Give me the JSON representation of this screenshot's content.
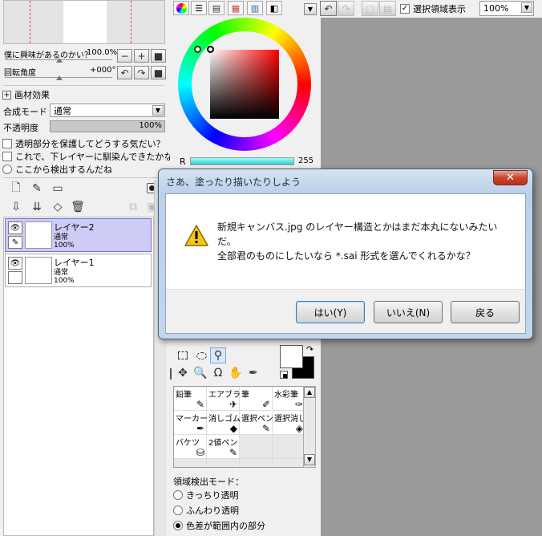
{
  "navigator": {
    "zoom_label": "僕に興味があるのかい？",
    "zoom_value": "100.0%",
    "rotate_label": "回転角度",
    "rotate_value": "+000°"
  },
  "brush_effects": {
    "label": "画材効果"
  },
  "blend": {
    "label": "合成モード",
    "value": "通常"
  },
  "opacity": {
    "label": "不透明度",
    "value": "100%",
    "fill": 1.0
  },
  "layer_options": [
    "透明部分を保護してどうする気だい？",
    "これで、下レイヤーに馴染んできたかな？",
    "ここから検出するんだね"
  ],
  "layers": [
    {
      "name": "レイヤー2",
      "mode": "通常",
      "opacity": "100%",
      "selected": true
    },
    {
      "name": "レイヤー1",
      "mode": "通常",
      "opacity": "100%",
      "selected": false
    }
  ],
  "color": {
    "r_label": "R",
    "r_value": "255",
    "r_fill": 1.0
  },
  "tools": [
    {
      "name": "鉛筆",
      "icon": "pencil-icon"
    },
    {
      "name": "エアブラシ",
      "icon": "airbrush-icon"
    },
    {
      "name": "筆",
      "icon": "brush-icon"
    },
    {
      "name": "水彩筆",
      "icon": "watercolor-icon"
    },
    {
      "name": "マーカー",
      "icon": "marker-icon"
    },
    {
      "name": "消しゴム",
      "icon": "eraser-icon"
    },
    {
      "name": "選択ペン",
      "icon": "select-pen-icon"
    },
    {
      "name": "選択消し",
      "icon": "select-erase-icon"
    },
    {
      "name": "バケツ",
      "icon": "bucket-icon"
    },
    {
      "name": "2値ペン",
      "icon": "binary-pen-icon"
    }
  ],
  "detect_mode": {
    "label": "領域検出モード：",
    "options": [
      "きっちり透明",
      "ふんわり透明",
      "色差が範囲内の部分"
    ],
    "selected": 2
  },
  "toolbar": {
    "show_selection_label": "選択領域表示",
    "show_selection_checked": true,
    "zoom": "100%"
  },
  "dialog": {
    "title": "さあ、塗ったり描いたりしよう",
    "message_line1": "新規キャンバス.jpg のレイヤー構造とかはまだ本丸にないみたい",
    "message_line2": "だ。",
    "message_line3": "全部君のものにしたいなら *.sai 形式を選んでくれるかな？",
    "yes_label": "はい(Y)",
    "no_label": "いいえ(N)",
    "back_label": "戻る",
    "close_label": "✕"
  }
}
